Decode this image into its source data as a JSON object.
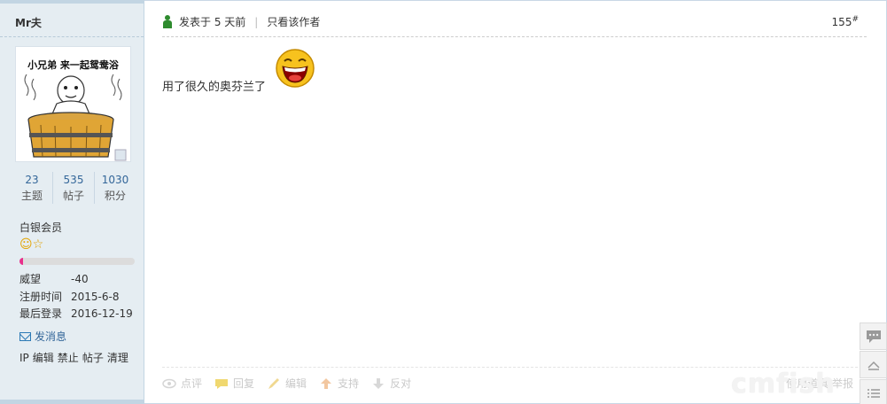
{
  "author": {
    "name": "Mr夫",
    "avatar_caption": "小兄弟 来一起鸳鸯浴",
    "stats": [
      {
        "value": "23",
        "label": "主题"
      },
      {
        "value": "535",
        "label": "帖子"
      },
      {
        "value": "1030",
        "label": "积分"
      }
    ],
    "group": "白银会员",
    "level_progress": 0.03,
    "info": [
      {
        "key": "威望",
        "value": "-40"
      },
      {
        "key": "注册时间",
        "value": "2015-6-8"
      },
      {
        "key": "最后登录",
        "value": "2016-12-19"
      }
    ],
    "send_message": "发消息",
    "admin_links": [
      "IP",
      "编辑",
      "禁止",
      "帖子",
      "清理"
    ]
  },
  "post": {
    "posted_at": "发表于 5 天前",
    "separator": "|",
    "only_author": "只看该作者",
    "floor": "155",
    "floor_mark": "#",
    "body_text": "用了很久的奥芬兰了"
  },
  "actions": {
    "items": [
      {
        "label": "点评",
        "icon": "eye-icon"
      },
      {
        "label": "回复",
        "icon": "comment-icon"
      },
      {
        "label": "编辑",
        "icon": "pencil-icon"
      },
      {
        "label": "支持",
        "icon": "arrow-up-icon"
      },
      {
        "label": "反对",
        "icon": "arrow-down-icon"
      }
    ],
    "right_text": "使用道具 举报"
  },
  "watermark": "cmfish",
  "colors": {
    "sidebar_bg": "#e5edf2",
    "link": "#336699",
    "progress_fill": "#e8308c"
  }
}
